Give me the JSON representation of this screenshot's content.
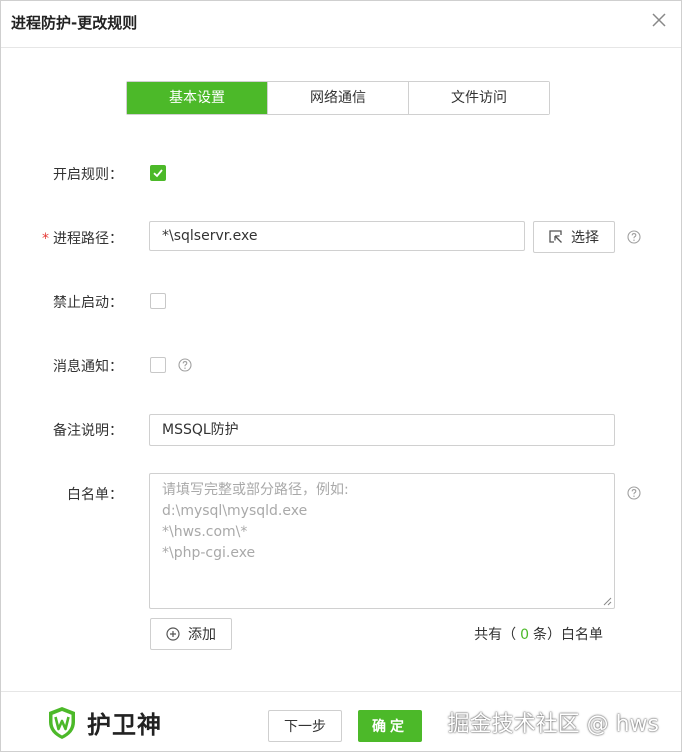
{
  "dialog": {
    "title": "进程防护-更改规则"
  },
  "tabs": [
    {
      "label": "基本设置",
      "active": true
    },
    {
      "label": "网络通信",
      "active": false
    },
    {
      "label": "文件访问",
      "active": false
    }
  ],
  "form": {
    "enable_rule": {
      "label": "开启规则：",
      "checked": true
    },
    "process_path": {
      "required_mark": "*",
      "label": "进程路径：",
      "value": "*\\sqlservr.exe",
      "select_label": "选择"
    },
    "forbid_start": {
      "label": "禁止启动：",
      "checked": false
    },
    "notify": {
      "label": "消息通知：",
      "checked": false
    },
    "remark": {
      "label": "备注说明：",
      "value": "MSSQL防护"
    },
    "whitelist": {
      "label": "白名单：",
      "placeholder_lines": [
        "请填写完整或部分路径，例如:",
        "d:\\mysql\\mysqld.exe",
        "*\\hws.com\\*",
        "*\\php-cgi.exe"
      ],
      "add_label": "添加",
      "count_prefix": "共有（",
      "count_value": "0",
      "count_suffix": "条）白名单"
    }
  },
  "footer": {
    "brand_name": "护卫神",
    "prev_label": "下一步",
    "confirm_label": "确定",
    "watermark": "掘金技术社区 @ hws"
  },
  "colors": {
    "accent": "#4cb929",
    "required": "#e53935"
  }
}
